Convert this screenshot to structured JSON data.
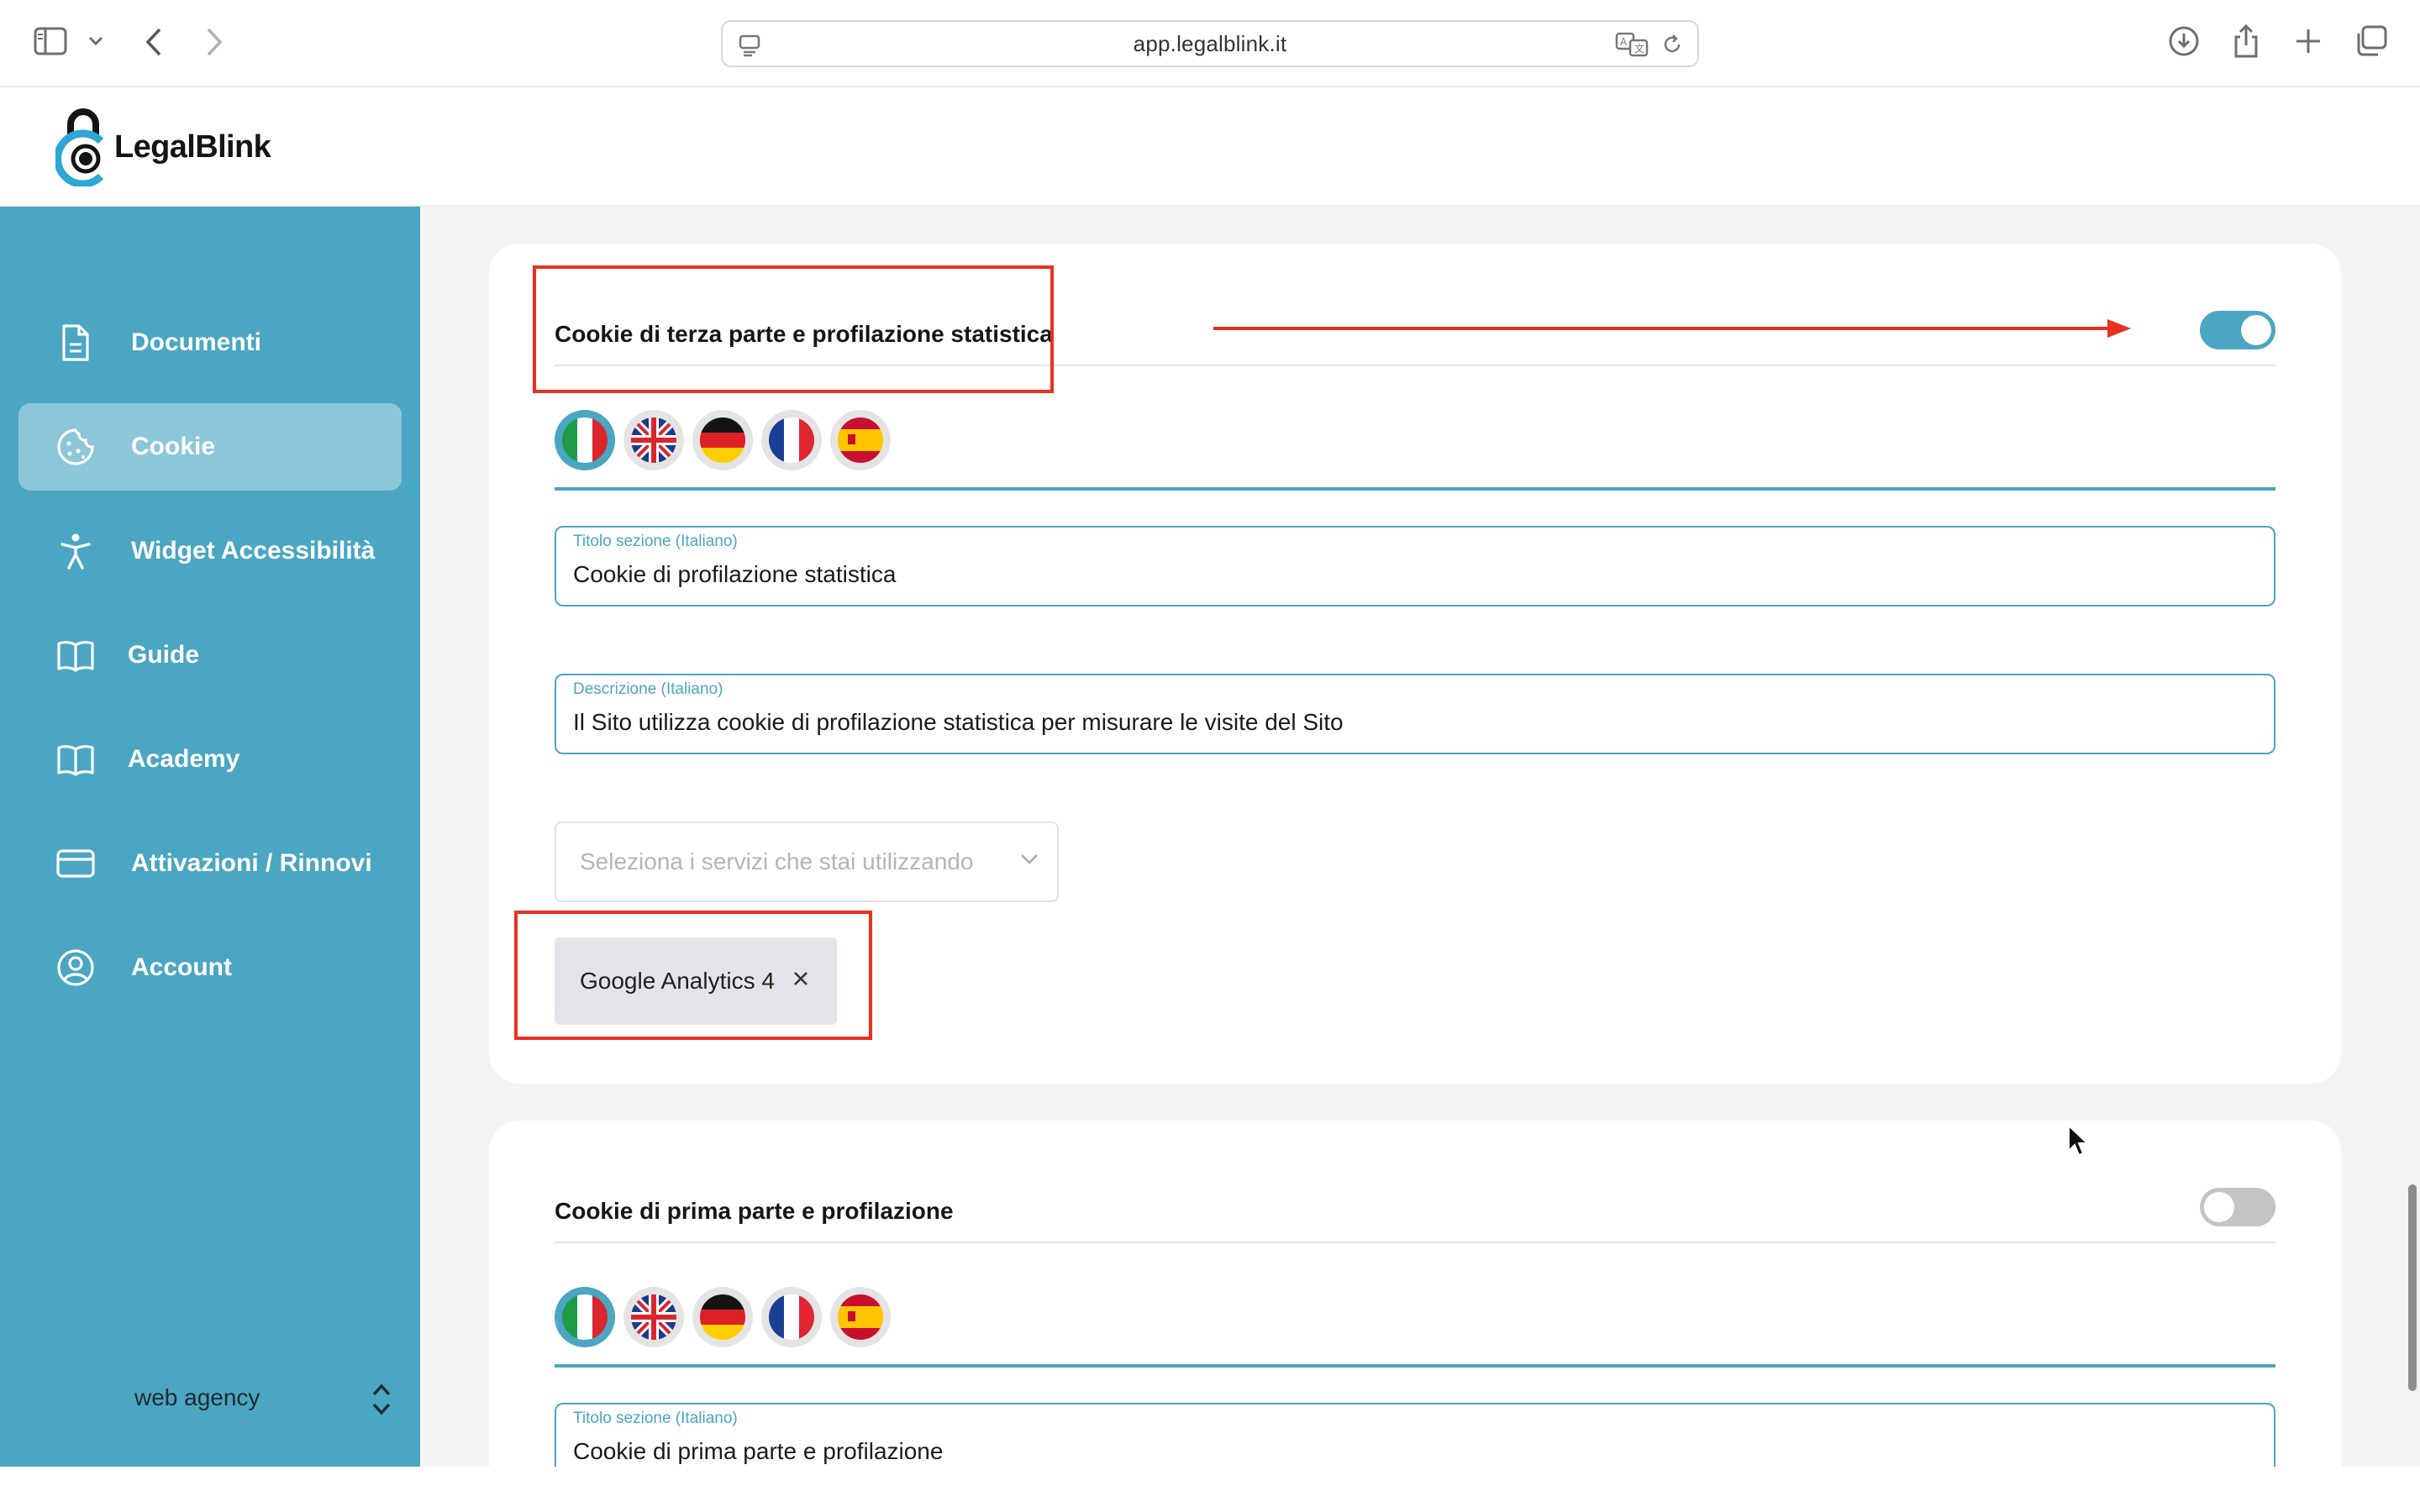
{
  "browser": {
    "url": "app.legalblink.it"
  },
  "app": {
    "logo_text": "LegalBlink"
  },
  "sidebar": {
    "items": [
      {
        "label": "Documenti",
        "icon": "document-icon"
      },
      {
        "label": "Cookie",
        "icon": "cookie-icon",
        "active": true
      },
      {
        "label": "Widget Accessibilità",
        "icon": "accessibility-icon"
      },
      {
        "label": "Guide",
        "icon": "book-icon"
      },
      {
        "label": "Academy",
        "icon": "book-icon"
      },
      {
        "label": "Attivazioni / Rinnovi",
        "icon": "credit-card-icon"
      },
      {
        "label": "Account",
        "icon": "user-circle-icon"
      }
    ],
    "footer_label": "web agency"
  },
  "sections": [
    {
      "title": "Cookie di terza parte e profilazione statistica",
      "enabled": true,
      "languages": [
        "it",
        "en",
        "de",
        "fr",
        "es"
      ],
      "active_language": "it",
      "title_field": {
        "label": "Titolo sezione (Italiano)",
        "value": "Cookie di profilazione statistica"
      },
      "description_field": {
        "label": "Descrizione (Italiano)",
        "value": "Il Sito utilizza cookie di profilazione statistica per misurare le visite del Sito"
      },
      "services_select": {
        "placeholder": "Seleziona i servizi che stai utilizzando"
      },
      "selected_services": [
        "Google Analytics 4"
      ]
    },
    {
      "title": "Cookie di prima parte e profilazione",
      "enabled": false,
      "languages": [
        "it",
        "en",
        "de",
        "fr",
        "es"
      ],
      "active_language": "it",
      "title_field": {
        "label": "Titolo sezione (Italiano)",
        "value": "Cookie di prima parte e profilazione"
      }
    }
  ],
  "colors": {
    "brand": "#4aa6c2",
    "annotation": "#e8311f"
  }
}
